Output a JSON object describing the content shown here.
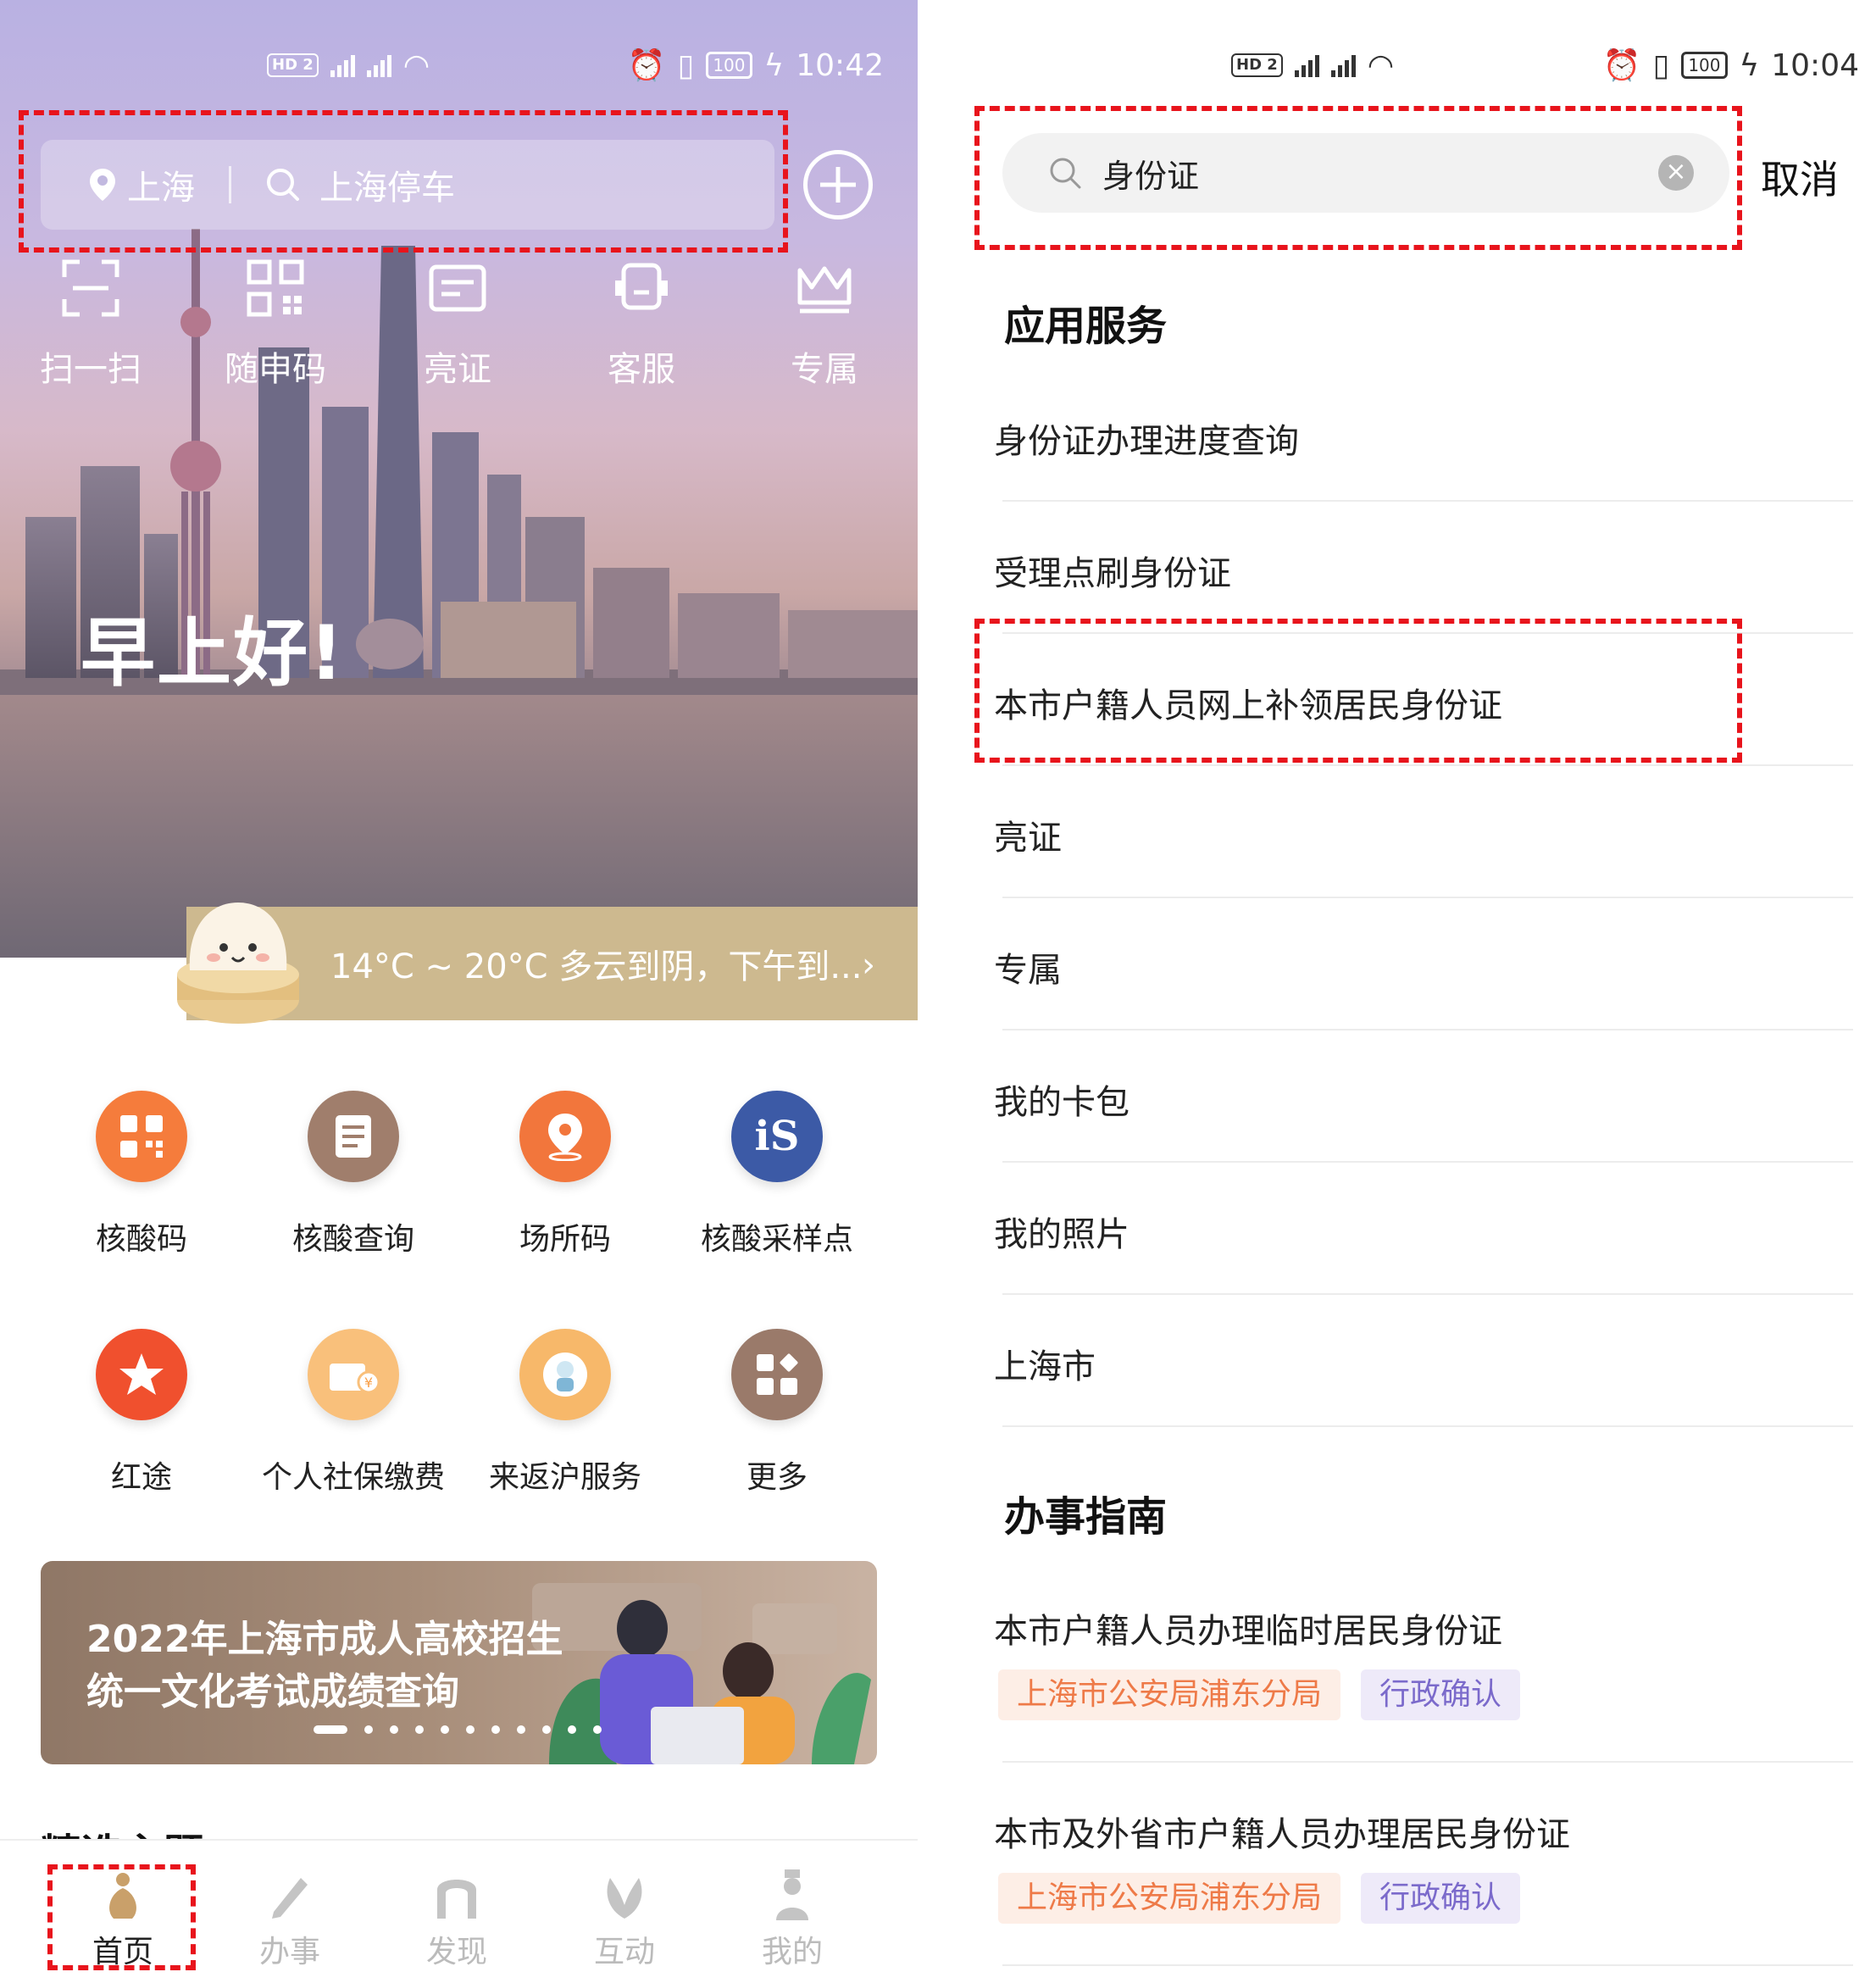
{
  "left": {
    "status": {
      "network": "HD 2",
      "time": "10:42",
      "battery": "100"
    },
    "search": {
      "location": "上海",
      "query": "上海停车"
    },
    "quick_actions": [
      {
        "label": "扫一扫",
        "icon": "scan-icon"
      },
      {
        "label": "随申码",
        "icon": "qr-code-icon"
      },
      {
        "label": "亮证",
        "icon": "id-card-icon"
      },
      {
        "label": "客服",
        "icon": "headset-icon"
      },
      {
        "label": "专属",
        "icon": "crown-icon"
      }
    ],
    "greeting": "早上好!",
    "weather": "14°C ~ 20°C  多云到阴，下午到...",
    "services": [
      {
        "label": "核酸码",
        "icon": "qr-code-icon",
        "color": "#f57c3c"
      },
      {
        "label": "核酸查询",
        "icon": "document-icon",
        "color": "#a07e6c"
      },
      {
        "label": "场所码",
        "icon": "location-pin-icon",
        "color": "#f2763c"
      },
      {
        "label": "核酸采样点",
        "icon": "is-logo-icon",
        "color": "#3c5aa6"
      },
      {
        "label": "红途",
        "icon": "star-icon",
        "color": "#f0502e"
      },
      {
        "label": "个人社保缴费",
        "icon": "payment-icon",
        "color": "#f9c07b"
      },
      {
        "label": "来返沪服务",
        "icon": "mascot-icon",
        "color": "#f7b86a"
      },
      {
        "label": "更多",
        "icon": "grid-icon",
        "color": "#9a7a6a"
      }
    ],
    "banner": {
      "line1": "2022年上海市成人高校招生",
      "line2": "统一文化考试成绩查询"
    },
    "section_peek": "精选主题",
    "tabs": [
      {
        "label": "首页",
        "icon": "gourd-icon",
        "active": true
      },
      {
        "label": "办事",
        "icon": "pen-icon",
        "active": false
      },
      {
        "label": "发现",
        "icon": "gate-icon",
        "active": false
      },
      {
        "label": "互动",
        "icon": "magnolia-icon",
        "active": false
      },
      {
        "label": "我的",
        "icon": "person-icon",
        "active": false
      }
    ]
  },
  "right": {
    "status": {
      "network": "HD 2",
      "time": "10:04",
      "battery": "100"
    },
    "search": {
      "value": "身份证",
      "cancel": "取消"
    },
    "app_services_title": "应用服务",
    "app_services": [
      "身份证办理进度查询",
      "受理点刷身份证",
      "本市户籍人员网上补领居民身份证",
      "亮证",
      "专属",
      "我的卡包",
      "我的照片",
      "上海市"
    ],
    "guides_title": "办事指南",
    "guides": [
      {
        "title": "本市户籍人员办理临时居民身份证",
        "org": "上海市公安局浦东分局",
        "type": "行政确认"
      },
      {
        "title": "本市及外省市户籍人员办理居民身份证",
        "org": "上海市公安局浦东分局",
        "type": "行政确认"
      }
    ]
  },
  "colors": {
    "highlight": "#e8141c",
    "weather_bar": "#cdb98f",
    "tag_org": "#ee7a48",
    "tag_type": "#7b6acb"
  }
}
